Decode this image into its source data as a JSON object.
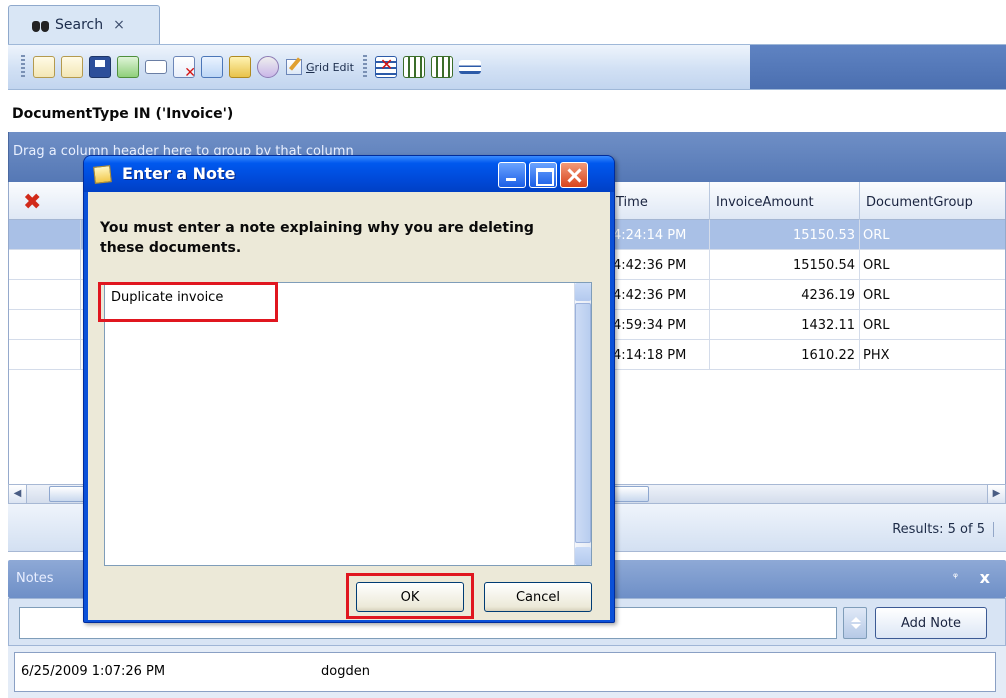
{
  "tab": {
    "label": "Search",
    "close": "×"
  },
  "toolbar": {
    "grid_edit_label": "Grid Edit",
    "grid_edit_mnemonic": "G",
    "grid_edit_rest": "rid Edit"
  },
  "filter_text": "DocumentType IN ('Invoice')",
  "group_hint": "Drag a column header here to group by that column",
  "grid": {
    "columns": [
      "Time",
      "InvoiceAmount",
      "DocumentGroup"
    ],
    "rows": [
      {
        "time": "4:24:14 PM",
        "amount": "15150.53",
        "group": "ORL",
        "selected": true
      },
      {
        "time": "4:42:36 PM",
        "amount": "15150.54",
        "group": "ORL",
        "selected": false
      },
      {
        "time": "4:42:36 PM",
        "amount": "4236.19",
        "group": "ORL",
        "selected": false
      },
      {
        "time": "4:59:34 PM",
        "amount": "1432.11",
        "group": "ORL",
        "selected": false
      },
      {
        "time": "4:14:18 PM",
        "amount": "1610.22",
        "group": "PHX",
        "selected": false
      }
    ]
  },
  "results": "Results: 5 of 5",
  "notes": {
    "title": "Notes",
    "pin": "ᵠ",
    "close": "x",
    "add_button": "Add Note",
    "entries": [
      {
        "date": "6/25/2009 1:07:26 PM",
        "user": "dogden"
      }
    ]
  },
  "dialog": {
    "title": "Enter a Note",
    "message": "You must enter a note explaining why you are deleting these documents.",
    "note_value": "Duplicate invoice",
    "ok_label": "OK",
    "cancel_label": "Cancel"
  }
}
